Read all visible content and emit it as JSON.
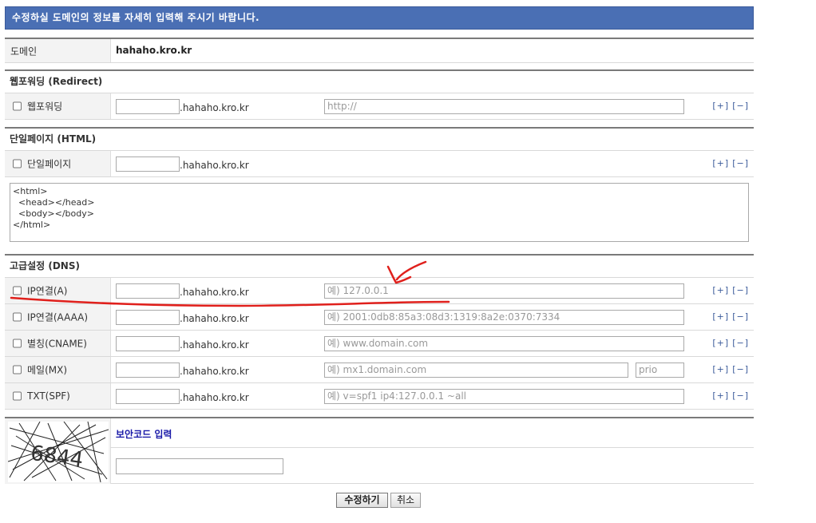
{
  "banner": "수정하실 도메인의 정보를 자세히 입력해 주시기 바랍니다.",
  "domain": {
    "label": "도메인",
    "value": "hahaho.kro.kr"
  },
  "suffix": ".hahaho.kro.kr",
  "plusminus": [
    "[+]",
    "[−]"
  ],
  "redirect": {
    "title": "웹포워딩 (Redirect)",
    "row_label": "웹포워딩",
    "url_placeholder": "http://"
  },
  "html_page": {
    "title": "단일페이지 (HTML)",
    "row_label": "단일페이지",
    "textarea": "<html>\n  <head></head>\n  <body></body>\n</html>"
  },
  "dns": {
    "title": "고급설정 (DNS)",
    "records": [
      {
        "label": "IP연결(A)",
        "placeholder": "예) 127.0.0.1"
      },
      {
        "label": "IP연결(AAAA)",
        "placeholder": "예) 2001:0db8:85a3:08d3:1319:8a2e:0370:7334"
      },
      {
        "label": "별칭(CNAME)",
        "placeholder": "예) www.domain.com"
      },
      {
        "label": "메일(MX)",
        "placeholder": "예) mx1.domain.com",
        "prio_placeholder": "prio"
      },
      {
        "label": "TXT(SPF)",
        "placeholder": "예) v=spf1 ip4:127.0.0.1 ~all"
      }
    ]
  },
  "captcha": {
    "label": "보안코드 입력",
    "code": "6844"
  },
  "buttons": {
    "submit": "수정하기",
    "cancel": "취소"
  },
  "colors": {
    "banner": "#4a6fb4",
    "annotation": "#e0201c",
    "link": "#3a5a9a"
  }
}
